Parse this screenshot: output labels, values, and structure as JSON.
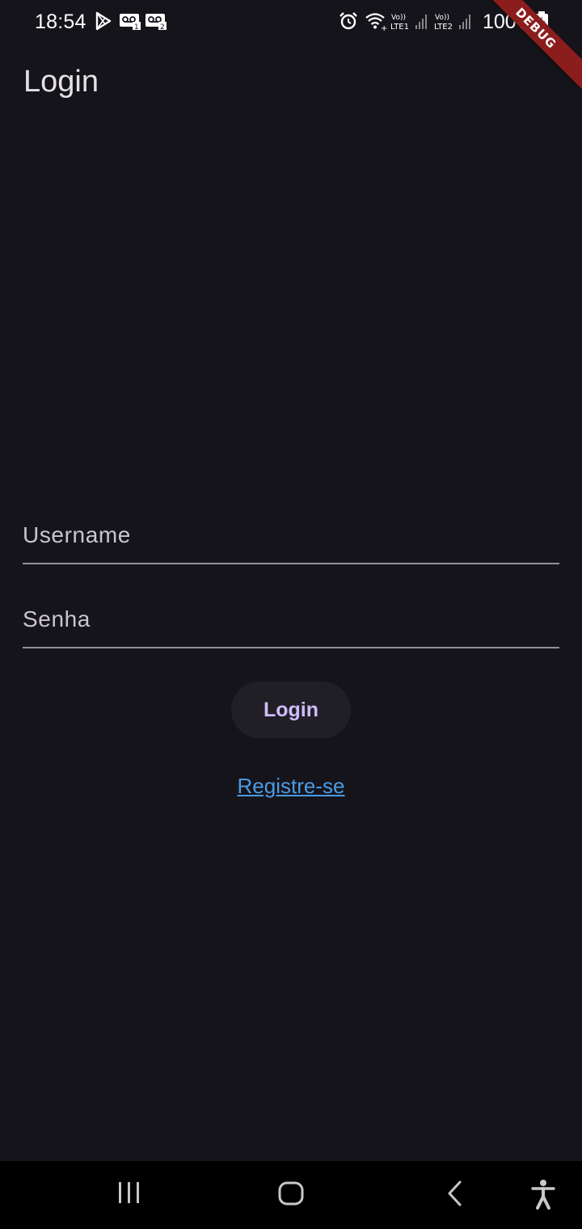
{
  "status_bar": {
    "time": "18:54",
    "battery": "100%",
    "icons": [
      "play-store-icon",
      "voicemail-icon",
      "voicemail-icon",
      "alarm-icon",
      "wifi-icon",
      "volte-lte1-signal-icon",
      "volte-lte2-signal-icon",
      "battery-charging-icon"
    ]
  },
  "debug_banner": "DEBUG",
  "app_bar": {
    "title": "Login"
  },
  "form": {
    "username_placeholder": "Username",
    "username_value": "",
    "password_placeholder": "Senha",
    "password_value": ""
  },
  "actions": {
    "login_label": "Login",
    "register_label": "Registre-se"
  },
  "nav_bar": {
    "icons": [
      "recent-apps-icon",
      "home-icon",
      "back-icon",
      "accessibility-icon"
    ]
  },
  "colors": {
    "background": "#16141b",
    "button_text": "#d0bcff",
    "link": "#4a9be4",
    "debug_ribbon": "#8b1d1d"
  }
}
